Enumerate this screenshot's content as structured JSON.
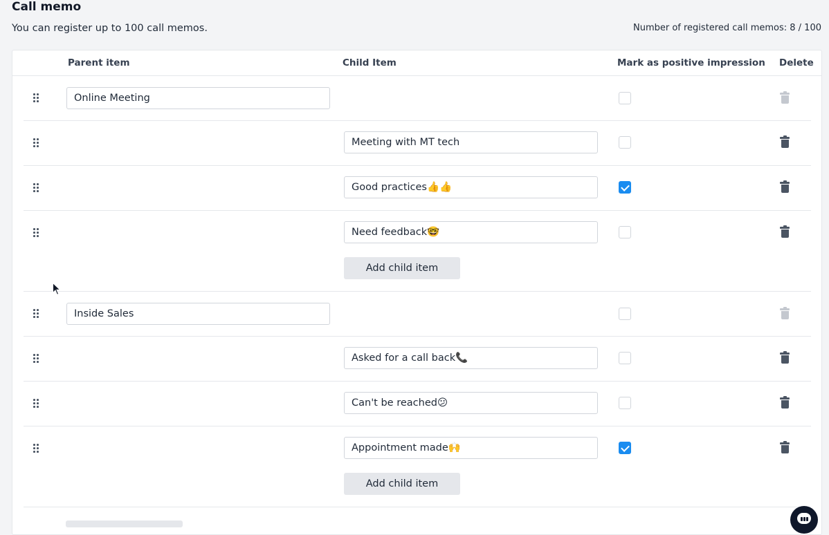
{
  "page": {
    "title": "Call memo",
    "subtitle": "You can register up to 100 call memos.",
    "count": "Number of registered call memos: 8 / 100"
  },
  "table": {
    "headers": {
      "parent": "Parent item",
      "child": "Child Item",
      "positive": "Mark as positive impression",
      "delete": "Delete"
    },
    "add_child_label": "Add child item",
    "groups": [
      {
        "parent": "Online Meeting",
        "children": [
          {
            "text": "Meeting with MT tech",
            "positive": false
          },
          {
            "text": "Good practices👍👍",
            "positive": true
          },
          {
            "text": "Need feedback🤓",
            "positive": false
          }
        ]
      },
      {
        "parent": "Inside Sales",
        "children": [
          {
            "text": "Asked for a call back📞",
            "positive": false
          },
          {
            "text": "Can't be reached😕",
            "positive": false
          },
          {
            "text": "Appointment made🙌",
            "positive": true
          }
        ]
      }
    ]
  },
  "icons": {
    "drag": "drag-handle-icon",
    "delete": "trash-icon",
    "chat": "chat-icon",
    "cursor": "mouse-cursor"
  },
  "colors": {
    "checkbox_checked": "#1a8cf0",
    "trash_active": "#4b5563",
    "trash_disabled": "#c4c8cf"
  }
}
